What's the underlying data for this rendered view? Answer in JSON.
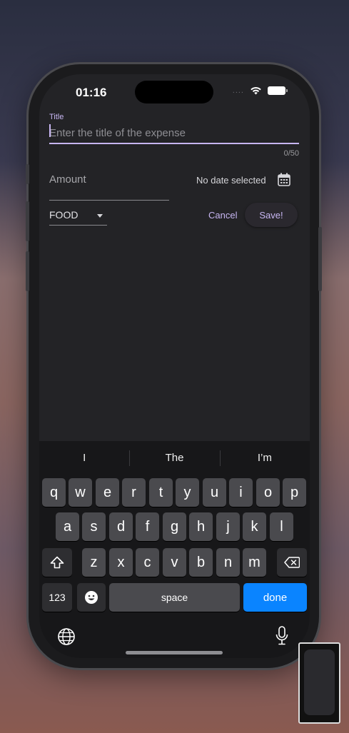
{
  "status_bar": {
    "time": "01:16",
    "signal": "....",
    "wifi_icon": "wifi-icon",
    "battery_icon": "battery-icon"
  },
  "form": {
    "title_label": "Title",
    "title_placeholder": "Enter the title of the expense",
    "title_counter": "0/50",
    "amount_label": "Amount",
    "date_text": "No date selected",
    "date_icon": "calendar-icon",
    "category_value": "FOOD",
    "cancel_label": "Cancel",
    "save_label": "Save!"
  },
  "keyboard": {
    "suggestions": [
      "I",
      "The",
      "I’m"
    ],
    "row1": [
      "q",
      "w",
      "e",
      "r",
      "t",
      "y",
      "u",
      "i",
      "o",
      "p"
    ],
    "row2": [
      "a",
      "s",
      "d",
      "f",
      "g",
      "h",
      "j",
      "k",
      "l"
    ],
    "row3": [
      "z",
      "x",
      "c",
      "v",
      "b",
      "n",
      "m"
    ],
    "numbers_label": "123",
    "space_label": "space",
    "done_label": "done",
    "shift_icon": "shift-icon",
    "delete_icon": "delete-icon",
    "emoji_icon": "emoji-icon",
    "globe_icon": "globe-icon",
    "mic_icon": "microphone-icon"
  },
  "colors": {
    "accent": "#c7b6f2",
    "done_button": "#0a84ff",
    "screen_bg": "#232326"
  }
}
